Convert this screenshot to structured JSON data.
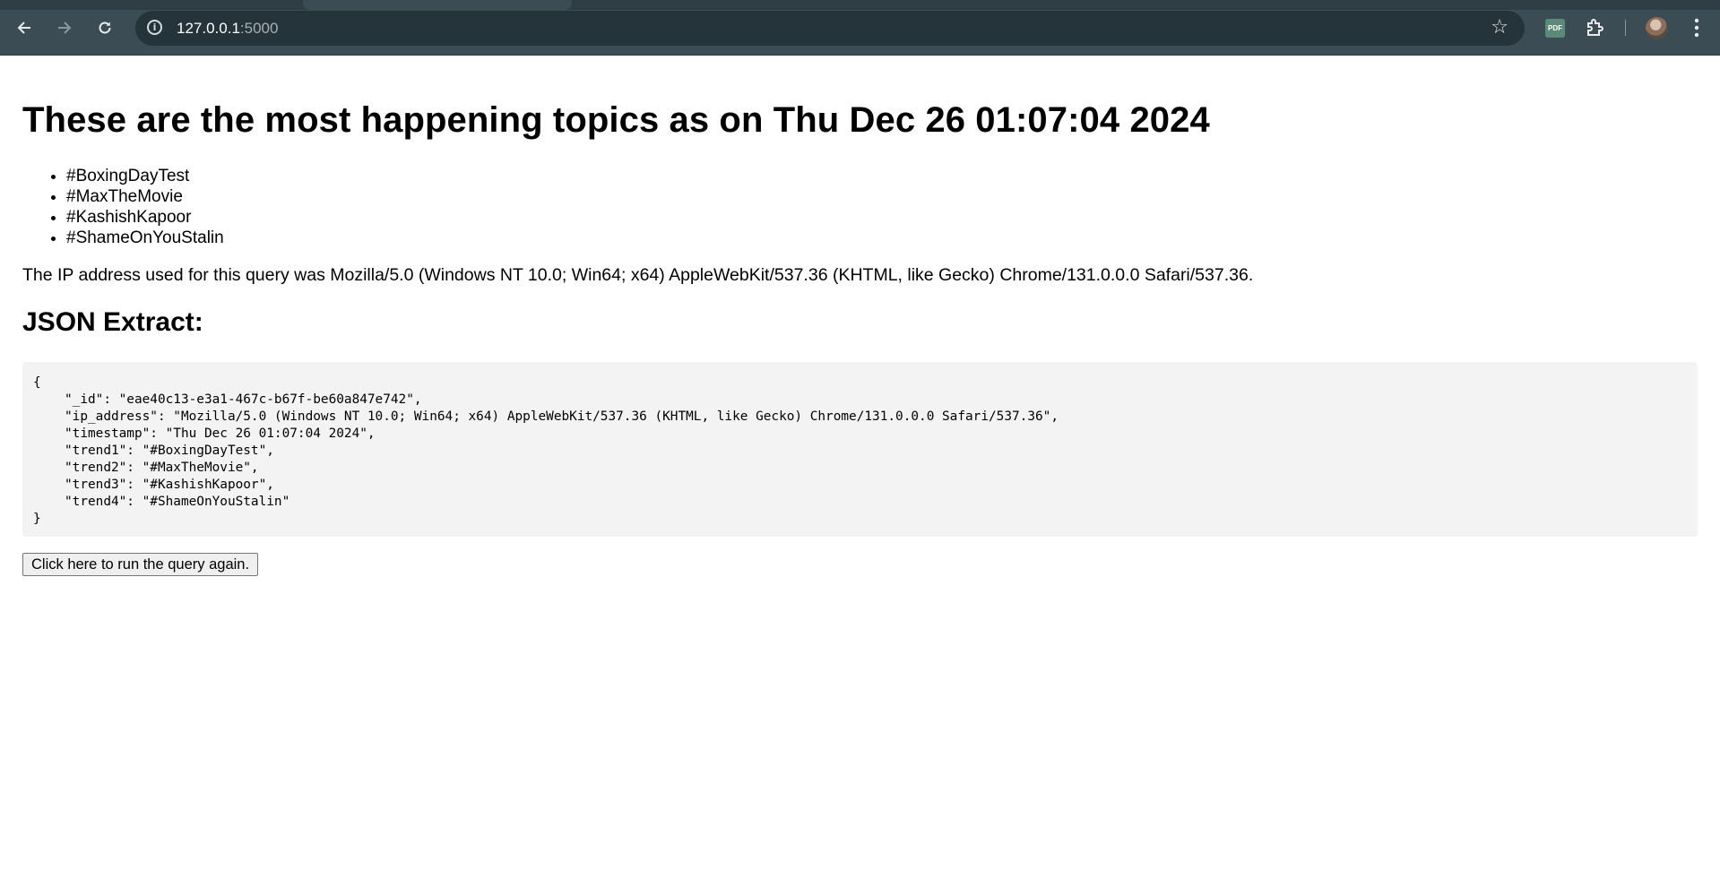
{
  "browser": {
    "url_host": "127.0.0.1",
    "url_port": ":5000",
    "extension_badge": "PDF"
  },
  "page": {
    "heading": "These are the most happening topics as on Thu Dec 26 01:07:04 2024",
    "trends": [
      "#BoxingDayTest",
      "#MaxTheMovie",
      "#KashishKapoor",
      "#ShameOnYouStalin"
    ],
    "ip_line": "The IP address used for this query was Mozilla/5.0 (Windows NT 10.0; Win64; x64) AppleWebKit/537.36 (KHTML, like Gecko) Chrome/131.0.0.0 Safari/537.36.",
    "json_heading": "JSON Extract:",
    "json_lines": {
      "open": "{",
      "id": "\"_id\": \"eae40c13-e3a1-467c-b67f-be60a847e742\",",
      "ip": "\"ip_address\": \"Mozilla/5.0 (Windows NT 10.0; Win64; x64) AppleWebKit/537.36 (KHTML, like Gecko) Chrome/131.0.0.0 Safari/537.36\",",
      "timestamp": "\"timestamp\": \"Thu Dec 26 01:07:04 2024\",",
      "trend1": "\"trend1\": \"#BoxingDayTest\",",
      "trend2": "\"trend2\": \"#MaxTheMovie\",",
      "trend3": "\"trend3\": \"#KashishKapoor\",",
      "trend4": "\"trend4\": \"#ShameOnYouStalin\"",
      "close": "}"
    },
    "button_label": "Click here to run the query again."
  }
}
